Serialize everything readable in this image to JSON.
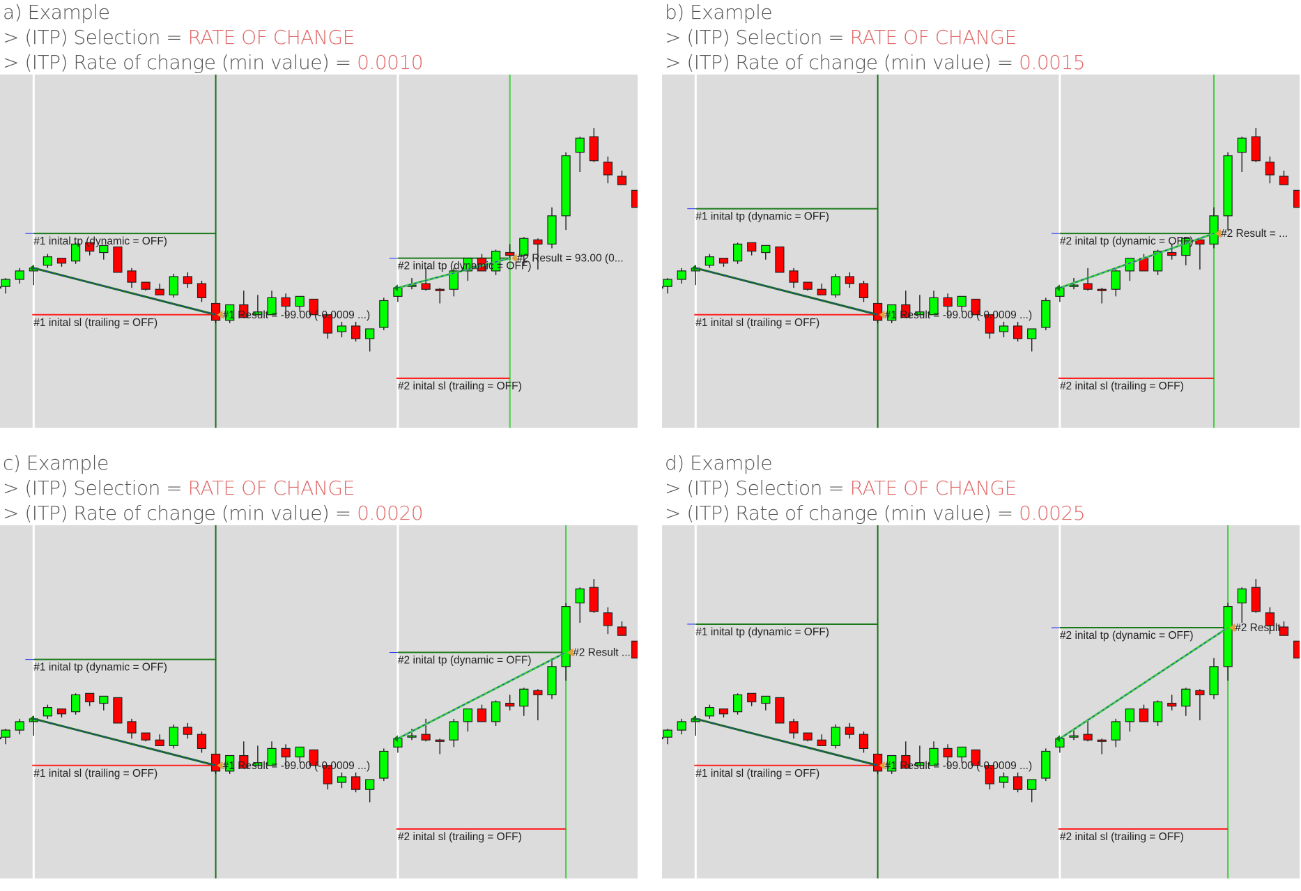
{
  "chart_data": [
    {
      "type": "candlestick",
      "id": "a",
      "title": "a) Example",
      "selection_label": "> (ITP) Selection = ",
      "selection_value": "RATE OF CHANGE",
      "roc_label": "> (ITP) Rate of change (min value) = ",
      "roc_value": "0.0010",
      "trade1": {
        "tp_label": "#1 inital tp (dynamic = OFF)",
        "sl_label": "#1 inital sl (trailing = OFF)",
        "result_label": "#1 Result = -99.00 (-0.0009 ...)",
        "entry_index": 3,
        "exit_index": 16,
        "tp": 107.5,
        "sl": 96.0
      },
      "trade2": {
        "tp_label": "#2 inital tp (dynamic = OFF)",
        "sl_label": "#2 inital sl (trailing = OFF)",
        "result_label": "#2 Result = 93.00 (0...",
        "entry_index": 29,
        "exit_index": 37,
        "tp": 104.0,
        "sl": 87.0,
        "exit_price": 104.0
      }
    },
    {
      "type": "candlestick",
      "id": "b",
      "title": "b) Example",
      "selection_label": "> (ITP) Selection = ",
      "selection_value": "RATE OF CHANGE",
      "roc_label": "> (ITP) Rate of change (min value) = ",
      "roc_value": "0.0015",
      "trade1": {
        "tp_label": "#1 inital tp (dynamic = OFF)",
        "sl_label": "#1 inital sl (trailing = OFF)",
        "result_label": "#1 Result = -99.00 (-0.0009 ...)",
        "entry_index": 3,
        "exit_index": 16,
        "tp": 111.0,
        "sl": 96.0
      },
      "trade2": {
        "tp_label": "#2 inital tp (dynamic = OFF)",
        "sl_label": "#2 inital sl (trailing = OFF)",
        "result_label": "#2 Result = ...",
        "entry_index": 29,
        "exit_index": 40,
        "tp": 107.5,
        "sl": 87.0,
        "exit_price": 107.5
      }
    },
    {
      "type": "candlestick",
      "id": "c",
      "title": "c) Example",
      "selection_label": "> (ITP) Selection = ",
      "selection_value": "RATE OF CHANGE",
      "roc_label": "> (ITP) Rate of change (min value) = ",
      "roc_value": "0.0020",
      "trade1": {
        "tp_label": "#1 inital tp (dynamic = OFF)",
        "sl_label": "#1 inital sl (trailing = OFF)",
        "result_label": "#1 Result = -99.00 (-0.0009 ...)",
        "entry_index": 3,
        "exit_index": 16,
        "tp": 111.0,
        "sl": 96.0
      },
      "trade2": {
        "tp_label": "#2 inital tp (dynamic = OFF)",
        "sl_label": "#2 inital sl (trailing = OFF)",
        "result_label": "#2 Result ...",
        "entry_index": 29,
        "exit_index": 41,
        "tp": 112.0,
        "sl": 87.0,
        "exit_price": 112.0
      }
    },
    {
      "type": "candlestick",
      "id": "d",
      "title": "d) Example",
      "selection_label": "> (ITP) Selection = ",
      "selection_value": "RATE OF CHANGE",
      "roc_label": "> (ITP) Rate of change (min value) = ",
      "roc_value": "0.0025",
      "trade1": {
        "tp_label": "#1 inital tp (dynamic = OFF)",
        "sl_label": "#1 inital sl (trailing = OFF)",
        "result_label": "#1 Result = -99.00 (-0.0009 ...)",
        "entry_index": 3,
        "exit_index": 16,
        "tp": 116.0,
        "sl": 96.0
      },
      "trade2": {
        "tp_label": "#2 inital tp (dynamic = OFF)",
        "sl_label": "#2 inital sl (trailing = OFF)",
        "result_label": "#2 Result",
        "entry_index": 29,
        "exit_index": 41,
        "tp": 115.5,
        "sl": 87.0,
        "exit_price": 115.5
      }
    }
  ],
  "candles": [
    {
      "o": 99.2,
      "h": 100.5,
      "l": 98.8,
      "c": 100.2
    },
    {
      "o": 100.0,
      "h": 101.2,
      "l": 99.0,
      "c": 101.0
    },
    {
      "o": 101.0,
      "h": 102.6,
      "l": 100.4,
      "c": 102.2
    },
    {
      "o": 102.2,
      "h": 103.0,
      "l": 100.2,
      "c": 102.6
    },
    {
      "o": 103.0,
      "h": 104.6,
      "l": 102.6,
      "c": 104.2
    },
    {
      "o": 104.0,
      "h": 104.0,
      "l": 102.8,
      "c": 103.3
    },
    {
      "o": 103.6,
      "h": 106.2,
      "l": 103.2,
      "c": 106.0
    },
    {
      "o": 106.2,
      "h": 106.2,
      "l": 104.4,
      "c": 105.0
    },
    {
      "o": 104.8,
      "h": 105.8,
      "l": 103.8,
      "c": 105.8
    },
    {
      "o": 105.6,
      "h": 105.6,
      "l": 102.0,
      "c": 102.0
    },
    {
      "o": 102.2,
      "h": 102.6,
      "l": 99.8,
      "c": 100.6
    },
    {
      "o": 100.6,
      "h": 100.6,
      "l": 99.4,
      "c": 99.6
    },
    {
      "o": 99.6,
      "h": 100.4,
      "l": 99.2,
      "c": 98.8
    },
    {
      "o": 98.8,
      "h": 101.8,
      "l": 98.4,
      "c": 101.4
    },
    {
      "o": 101.4,
      "h": 102.0,
      "l": 99.8,
      "c": 100.4
    },
    {
      "o": 100.4,
      "h": 100.8,
      "l": 97.8,
      "c": 98.4
    },
    {
      "o": 97.6,
      "h": 97.6,
      "l": 94.8,
      "c": 95.2
    },
    {
      "o": 95.2,
      "h": 97.4,
      "l": 94.8,
      "c": 97.4
    },
    {
      "o": 97.4,
      "h": 99.4,
      "l": 95.8,
      "c": 95.6
    },
    {
      "o": 96.0,
      "h": 98.8,
      "l": 96.0,
      "c": 96.4
    },
    {
      "o": 96.0,
      "h": 99.4,
      "l": 96.0,
      "c": 98.4
    },
    {
      "o": 98.4,
      "h": 99.0,
      "l": 95.6,
      "c": 97.2
    },
    {
      "o": 97.2,
      "h": 98.6,
      "l": 96.4,
      "c": 98.6
    },
    {
      "o": 98.2,
      "h": 98.2,
      "l": 96.0,
      "c": 96.0
    },
    {
      "o": 96.0,
      "h": 96.0,
      "l": 92.6,
      "c": 93.4
    },
    {
      "o": 93.6,
      "h": 95.0,
      "l": 92.8,
      "c": 94.4
    },
    {
      "o": 94.4,
      "h": 95.0,
      "l": 92.2,
      "c": 92.6
    },
    {
      "o": 92.6,
      "h": 94.0,
      "l": 90.8,
      "c": 94.0
    },
    {
      "o": 94.2,
      "h": 98.4,
      "l": 93.8,
      "c": 98.0
    },
    {
      "o": 98.6,
      "h": 99.8,
      "l": 97.8,
      "c": 99.8
    },
    {
      "o": 100.0,
      "h": 101.2,
      "l": 99.6,
      "c": 100.2
    },
    {
      "o": 100.4,
      "h": 102.6,
      "l": 99.4,
      "c": 99.6
    },
    {
      "o": 99.6,
      "h": 99.8,
      "l": 97.6,
      "c": 99.4
    },
    {
      "o": 99.6,
      "h": 102.6,
      "l": 98.6,
      "c": 102.2
    },
    {
      "o": 102.2,
      "h": 104.0,
      "l": 100.8,
      "c": 104.0
    },
    {
      "o": 104.0,
      "h": 104.6,
      "l": 102.2,
      "c": 102.2
    },
    {
      "o": 102.2,
      "h": 105.2,
      "l": 101.6,
      "c": 105.0
    },
    {
      "o": 104.8,
      "h": 106.0,
      "l": 103.8,
      "c": 104.4
    },
    {
      "o": 104.4,
      "h": 107.0,
      "l": 103.0,
      "c": 106.8
    },
    {
      "o": 106.6,
      "h": 106.8,
      "l": 102.4,
      "c": 106.0
    },
    {
      "o": 106.0,
      "h": 111.2,
      "l": 105.4,
      "c": 110.0
    },
    {
      "o": 110.0,
      "h": 119.0,
      "l": 108.0,
      "c": 118.5
    },
    {
      "o": 119.0,
      "h": 121.2,
      "l": 116.2,
      "c": 121.0
    },
    {
      "o": 121.2,
      "h": 122.4,
      "l": 117.6,
      "c": 117.8
    },
    {
      "o": 117.6,
      "h": 118.4,
      "l": 114.6,
      "c": 115.8
    },
    {
      "o": 115.6,
      "h": 116.4,
      "l": 114.4,
      "c": 114.4
    },
    {
      "o": 113.6,
      "h": 113.6,
      "l": 111.2,
      "c": 111.2
    }
  ],
  "axis": {
    "ymin": 80.0,
    "ymax": 130.0
  },
  "colors": {
    "up": "#00ff00",
    "down": "#ff0000",
    "accent": "#e06666",
    "tp_line": "#1a7a1a",
    "sl_line": "#ff2020",
    "exit_line_1": "#1a6e1a",
    "exit_line_2": "#40d040",
    "trade_line": "#2f9f2f",
    "background": "#dcdcdc"
  }
}
